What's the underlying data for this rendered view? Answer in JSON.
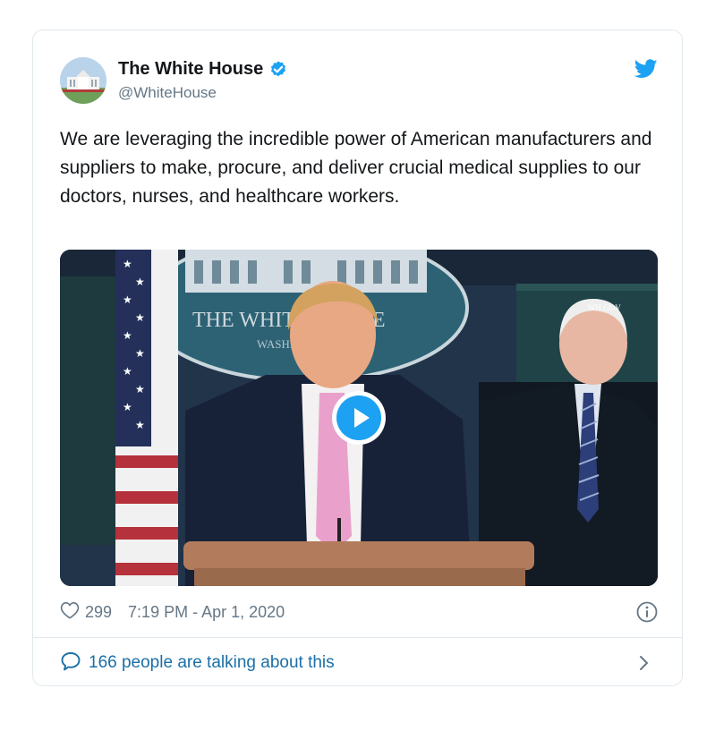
{
  "tweet": {
    "author_name": "The White House",
    "author_handle": "@WhiteHouse",
    "text": "We are leveraging the incredible power of American manufacturers and suppliers to make, procure, and deliver crucial medical supplies to our doctors, nurses, and healthcare workers.",
    "likes": "299",
    "timestamp": "7:19 PM - Apr 1, 2020",
    "conversation": "166 people are talking about this",
    "icons": {
      "verified": "verified-badge-icon",
      "bird": "twitter-bird-icon",
      "like": "heart-outline-icon",
      "info": "info-circle-icon",
      "reply": "speech-bubble-icon",
      "chevron": "chevron-right-icon",
      "play": "play-icon"
    }
  },
  "media": {
    "seal_text": "THE WHITE HOUSE",
    "seal_subtext": "WASHINGTON",
    "watermark": "WH.GOV"
  },
  "colors": {
    "twitter_blue": "#1da1f2",
    "link_blue": "#1b6fa6",
    "secondary_text": "#657786",
    "border": "#e1e8ed"
  }
}
